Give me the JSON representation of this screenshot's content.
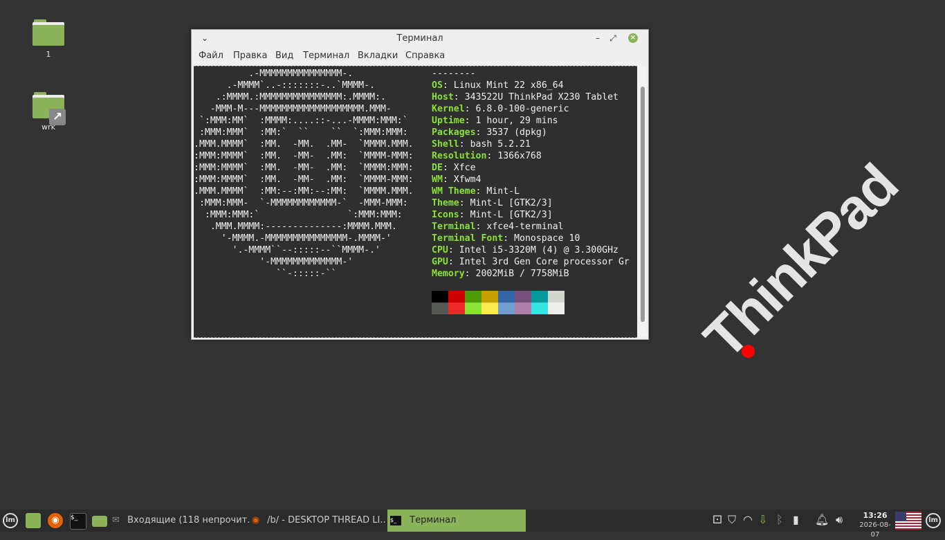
{
  "desktop": {
    "icons": [
      {
        "label": "1"
      },
      {
        "label": "wrk"
      }
    ],
    "wallpaper_logo": "ThinkPad",
    "logo_dot_color": "#ff0000"
  },
  "window": {
    "title": "Терминал",
    "menu": [
      "Файл",
      "Правка",
      "Вид",
      "Терминал",
      "Вкладки",
      "Справка"
    ]
  },
  "terminal": {
    "ascii_art_lines": [
      "          .-MMMMMMMMMMMMMMM-.",
      "      .-MMMM`..-:::::::-..`MMMM-.",
      "    .:MMMM.:MMMMMMMMMMMMMMM:.MMMM:.",
      "   -MMM-M---MMMMMMMMMMMMMMMMMMM.MMM-",
      " `:MMM:MM`  :MMMM:....::-...-MMMM:MMM:`",
      " :MMM:MMM`  :MM:`  ``    ``  `:MMM:MMM:",
      ".MMM.MMMM`  :MM.  -MM.  .MM-  `MMMM.MMM.",
      ":MMM:MMMM`  :MM.  -MM-  .MM:  `MMMM-MMM:",
      ":MMM:MMMM`  :MM.  -MM-  .MM:  `MMMM:MMM:",
      ":MMM:MMMM`  :MM.  -MM-  .MM:  `MMMM-MMM:",
      ".MMM.MMMM`  :MM:--:MM:--:MM:  `MMMM.MMM.",
      " :MMM:MMM-  `-MMMMMMMMMMMM-`  -MMM-MMM:",
      "  :MMM:MMM:`                `:MMM:MMM:",
      "   .MMM.MMMM:--------------:MMMM.MMM.",
      "     '-MMMM.-MMMMMMMMMMMMMMM-.MMMM-'",
      "       '.-MMMM``--:::::--``MMMM-.'",
      "            '-MMMMMMMMMMMMM-'",
      "               ``-:::::-``"
    ],
    "separator": "--------",
    "info": [
      {
        "key": "OS",
        "value": "Linux Mint 22 x86_64"
      },
      {
        "key": "Host",
        "value": "343522U ThinkPad X230 Tablet"
      },
      {
        "key": "Kernel",
        "value": "6.8.0-100-generic"
      },
      {
        "key": "Uptime",
        "value": "1 hour, 29 mins"
      },
      {
        "key": "Packages",
        "value": "3537 (dpkg)"
      },
      {
        "key": "Shell",
        "value": "bash 5.2.21"
      },
      {
        "key": "Resolution",
        "value": "1366x768"
      },
      {
        "key": "DE",
        "value": "Xfce"
      },
      {
        "key": "WM",
        "value": "Xfwm4"
      },
      {
        "key": "WM Theme",
        "value": "Mint-L"
      },
      {
        "key": "Theme",
        "value": "Mint-L [GTK2/3]"
      },
      {
        "key": "Icons",
        "value": "Mint-L [GTK2/3]"
      },
      {
        "key": "Terminal",
        "value": "xfce4-terminal"
      },
      {
        "key": "Terminal Font",
        "value": "Monospace 10"
      },
      {
        "key": "CPU",
        "value": "Intel i5-3320M (4) @ 3.300GHz"
      },
      {
        "key": "GPU",
        "value": "Intel 3rd Gen Core processor Gr"
      },
      {
        "key": "Memory",
        "value": "2002MiB / 7758MiB"
      }
    ],
    "palette_top": [
      "#000000",
      "#cc0000",
      "#4e9a06",
      "#c4a000",
      "#3465a4",
      "#75507b",
      "#06989a",
      "#d3d7cf"
    ],
    "palette_bottom": [
      "#555753",
      "#ef2929",
      "#8ae234",
      "#fce94f",
      "#729fcf",
      "#ad7fa8",
      "#34e2e2",
      "#eeeeec"
    ],
    "accent_color": "#8ae234"
  },
  "taskbar": {
    "tasks": [
      {
        "label": "Входящие (118 непрочит..."
      },
      {
        "label": "/b/ - DESKTOP THREAD LI..."
      },
      {
        "label": "Терминал"
      }
    ],
    "clock_time": "13:26",
    "clock_date": "2026-08-07",
    "accent_color": "#8ab35a"
  }
}
